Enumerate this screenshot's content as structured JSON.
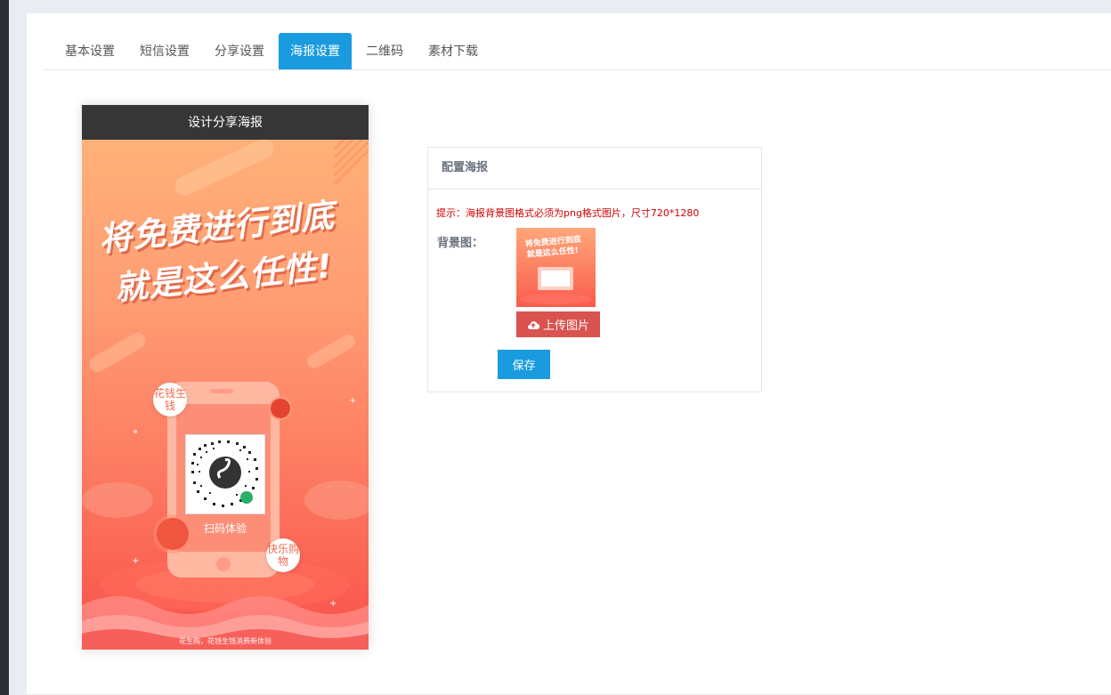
{
  "tabs": [
    {
      "label": "基本设置",
      "active": false
    },
    {
      "label": "短信设置",
      "active": false
    },
    {
      "label": "分享设置",
      "active": false
    },
    {
      "label": "海报设置",
      "active": true
    },
    {
      "label": "二维码",
      "active": false
    },
    {
      "label": "素材下载",
      "active": false
    }
  ],
  "poster": {
    "header": "设计分享海报",
    "slogan_line1": "将免费进行到底",
    "slogan_line2": "就是这么任性!",
    "bubble_top": "花钱生钱",
    "bubble_bottom": "快乐购物",
    "scan_label": "扫码体验",
    "footer": "花生购，花钱生钱消费新体验"
  },
  "config": {
    "title": "配置海报",
    "hint": "提示：海报背景图格式必须为png格式图片，尺寸720*1280",
    "bg_label": "背景图：",
    "upload_label": "上传图片",
    "save_label": "保存"
  },
  "colors": {
    "accent": "#1a9be0",
    "danger": "#d9534f",
    "hint": "#d40000"
  },
  "icons": {
    "upload": "cloud-upload-icon",
    "qr": "qr-code-icon",
    "miniprogram": "mini-program-icon"
  }
}
